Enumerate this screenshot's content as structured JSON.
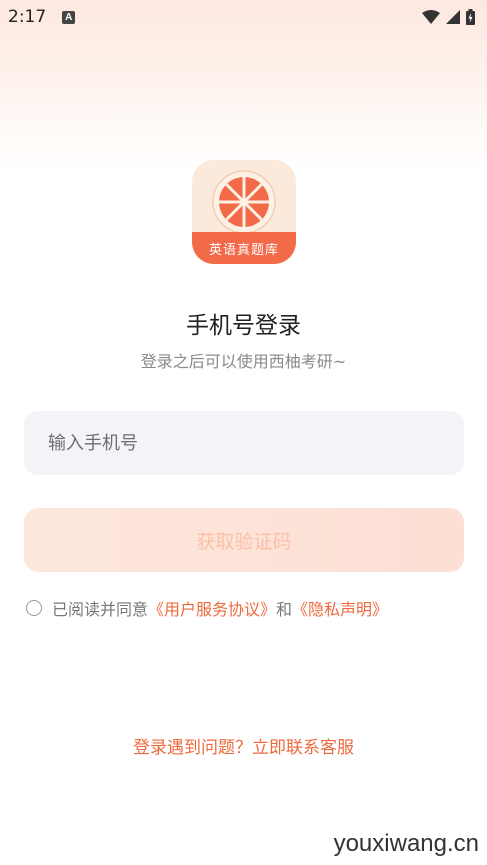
{
  "statusbar": {
    "time": "2:17",
    "notification_icon": "A"
  },
  "app_icon": {
    "banner": "英语真题库"
  },
  "title": "手机号登录",
  "subtitle": "登录之后可以使用西柚考研~",
  "phone_input": {
    "placeholder": "输入手机号",
    "value": ""
  },
  "code_button": {
    "label": "获取验证码"
  },
  "agreement": {
    "prefix": "已阅读并同意",
    "terms_link": "《用户服务协议》",
    "and": "和",
    "privacy_link": "《隐私声明》"
  },
  "help_link": "登录遇到问题？立即联系客服",
  "watermark": "youxiwang.cn",
  "colors": {
    "accent": "#ee6a3e",
    "button_bg": "#fde3d8",
    "input_bg": "#f3f4f8"
  }
}
